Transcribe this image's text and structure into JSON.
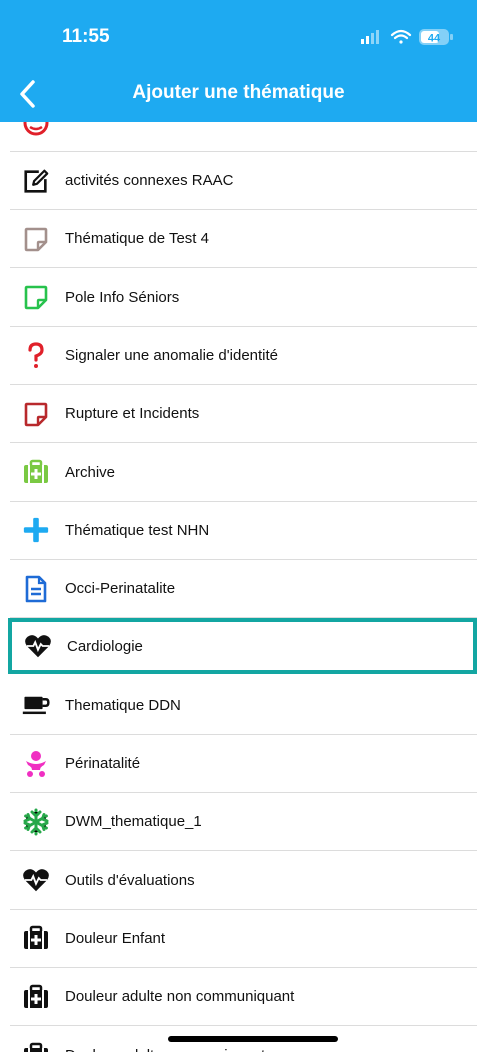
{
  "status": {
    "time": "11:55",
    "battery": "44"
  },
  "nav": {
    "title": "Ajouter une thématique"
  },
  "items": [
    {
      "label": "activités connexes RAAC",
      "icon": "edit-icon"
    },
    {
      "label": "Thématique de Test 4",
      "icon": "note-icon",
      "color": "#a3908c"
    },
    {
      "label": "Pole Info Séniors",
      "icon": "note-icon",
      "color": "#27c24c"
    },
    {
      "label": "Signaler une anomalie d'identité",
      "icon": "question-icon",
      "color": "#e0202a"
    },
    {
      "label": "Rupture et Incidents",
      "icon": "note-icon",
      "color": "#b8292c"
    },
    {
      "label": "Archive",
      "icon": "medkit-icon",
      "color": "#7ac943"
    },
    {
      "label": "Thématique test NHN",
      "icon": "plus-icon",
      "color": "#1eaaf1"
    },
    {
      "label": "Occi-Perinatalite",
      "icon": "document-icon",
      "color": "#1e6bd6"
    },
    {
      "label": "Cardiologie",
      "icon": "heartbeat-icon",
      "color": "#111111",
      "selected": true
    },
    {
      "label": "Thematique DDN",
      "icon": "coffee-icon",
      "color": "#111111"
    },
    {
      "label": "Périnatalité",
      "icon": "baby-icon",
      "color": "#f02fc2"
    },
    {
      "label": "DWM_thematique_1",
      "icon": "snowflake-icon",
      "color": "#27a84a"
    },
    {
      "label": "Outils d'évaluations",
      "icon": "heartbeat-icon",
      "color": "#111111"
    },
    {
      "label": "Douleur Enfant",
      "icon": "medkit-icon",
      "color": "#111111"
    },
    {
      "label": "Douleur adulte non communiquant",
      "icon": "medkit-icon",
      "color": "#111111"
    },
    {
      "label": "Douleur adulte communiquant",
      "icon": "medkit-icon",
      "color": "#111111"
    }
  ]
}
